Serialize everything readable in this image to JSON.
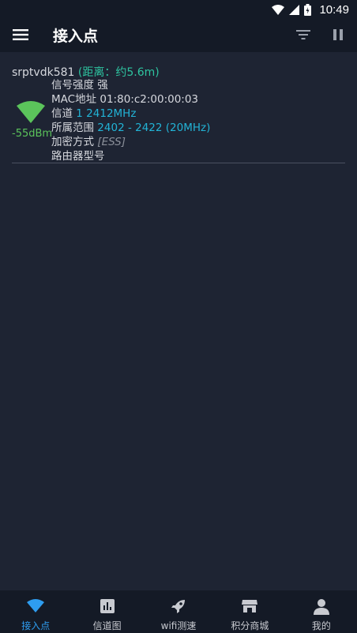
{
  "status_bar": {
    "time": "10:49",
    "icons": [
      "wifi-icon",
      "cell-signal-icon",
      "battery-icon"
    ]
  },
  "app_bar": {
    "title": "接入点",
    "icons": [
      "menu-icon",
      "filter-icon",
      "pause-icon"
    ]
  },
  "access_points": [
    {
      "ssid": "srptvdk581",
      "distance": "(距离：约5.6m)",
      "dbm": "-55dBm",
      "signal_label": "信号强度",
      "signal_value": "强",
      "mac_label": "MAC地址",
      "mac_value": "01:80:c2:00:00:03",
      "channel_label": "信道",
      "channel_value": "1 2412MHz",
      "range_label": "所属范围",
      "range_value": "2402 - 2422 (20MHz)",
      "encryption_label": "加密方式",
      "encryption_value": "[ESS]",
      "router_label": "路由器型号"
    }
  ],
  "bottom_nav": {
    "items": [
      {
        "label": "接入点",
        "icon": "wifi-icon",
        "active": true
      },
      {
        "label": "信道图",
        "icon": "bar-chart-icon",
        "active": false
      },
      {
        "label": "wifi测速",
        "icon": "rocket-icon",
        "active": false
      },
      {
        "label": "积分商城",
        "icon": "store-icon",
        "active": false
      },
      {
        "label": "我的",
        "icon": "person-icon",
        "active": false
      }
    ]
  },
  "colors": {
    "background": "#1e2433",
    "bar": "#141a26",
    "accent_blue": "#2e9df0",
    "cyan": "#22b3d6",
    "green": "#5bc45b",
    "teal": "#2ec4a0"
  }
}
